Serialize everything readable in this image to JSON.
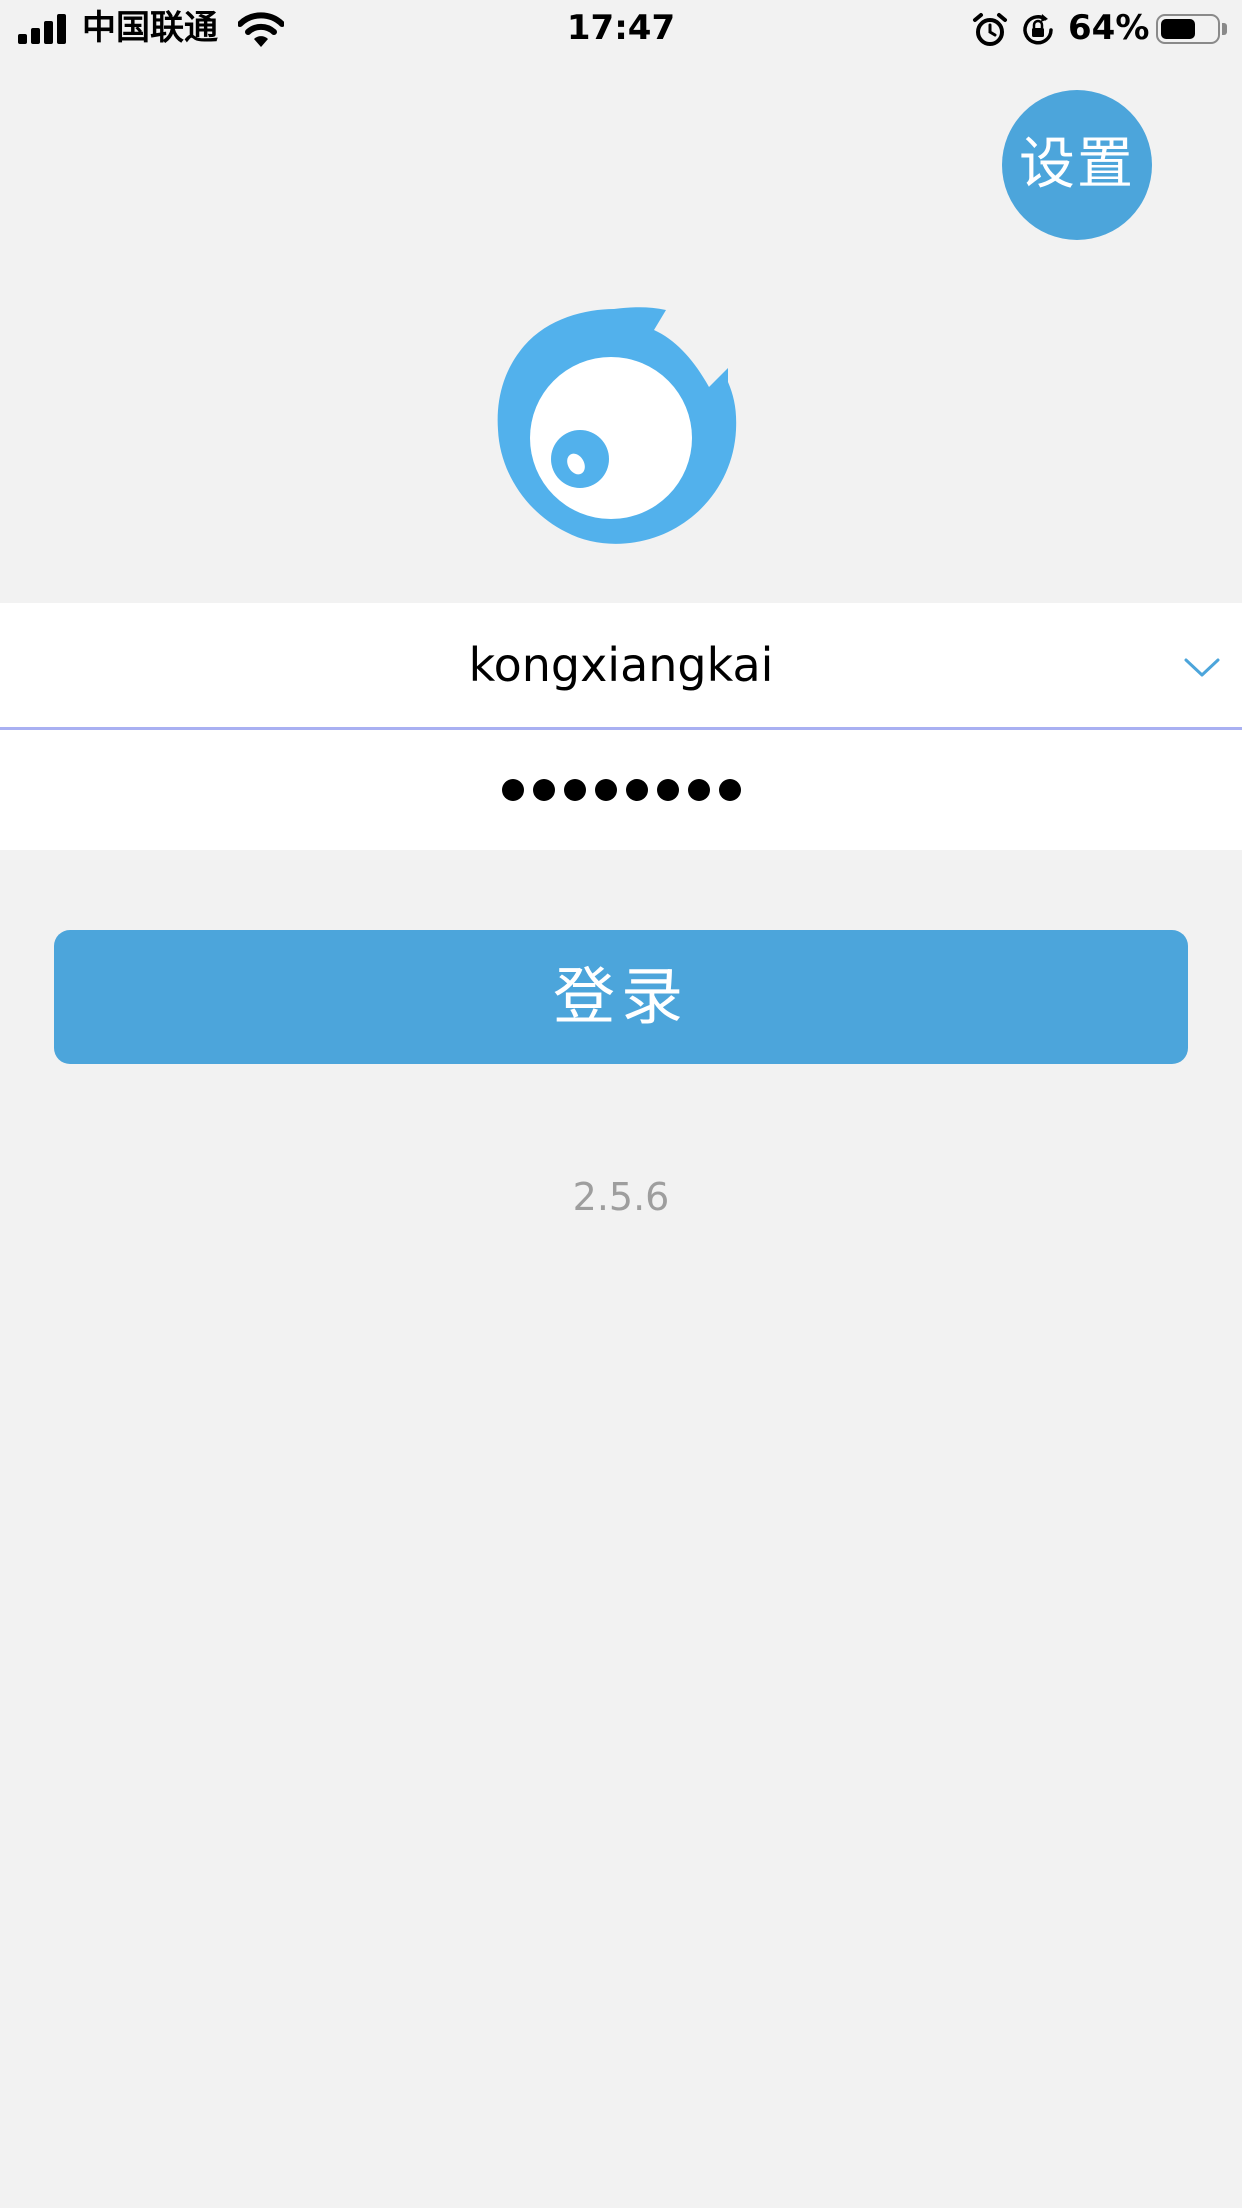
{
  "status_bar": {
    "carrier": "中国联通",
    "time": "17:47",
    "battery_percent": "64%",
    "battery_level": 0.64,
    "icons": [
      "signal-icon",
      "wifi-icon",
      "alarm-icon",
      "rotation-lock-icon",
      "battery-icon"
    ]
  },
  "header": {
    "settings_label": "设置"
  },
  "login_form": {
    "username_value": "kongxiangkai",
    "password_length": 8,
    "login_label": "登录"
  },
  "footer": {
    "version": "2.5.6"
  },
  "colors": {
    "accent": "#4ca5db",
    "logo_blue": "#52b1ec",
    "background": "#f2f2f2",
    "input_divider": "#a9b0f2",
    "version_text": "#9e9e9e"
  }
}
